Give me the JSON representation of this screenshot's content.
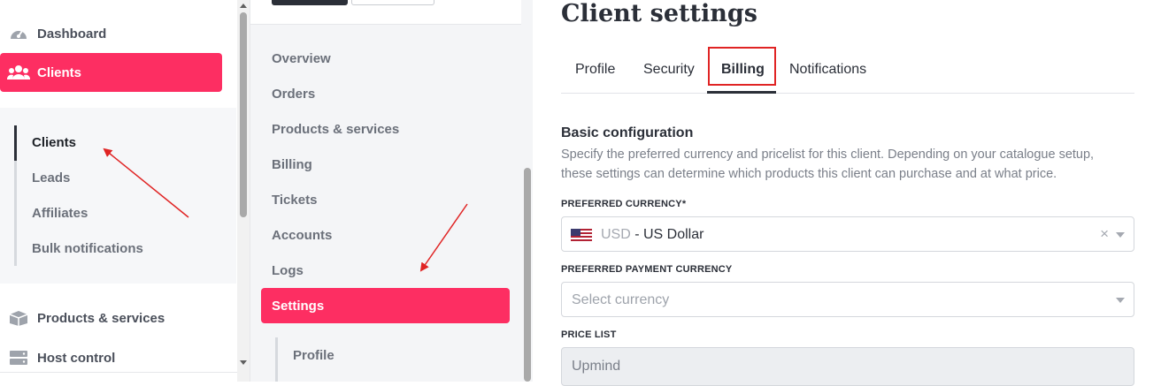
{
  "sidebar": {
    "items": [
      {
        "label": "Dashboard",
        "icon": "speedometer-icon"
      },
      {
        "label": "Clients",
        "icon": "users-icon",
        "active": true
      },
      {
        "label": "Products & services",
        "icon": "box-icon"
      },
      {
        "label": "Host control",
        "icon": "server-icon"
      }
    ],
    "sub_items": [
      "Clients",
      "Leads",
      "Affiliates",
      "Bulk notifications"
    ]
  },
  "midnav": {
    "items": [
      "Overview",
      "Orders",
      "Products & services",
      "Billing",
      "Tickets",
      "Accounts",
      "Logs"
    ],
    "active": "Settings",
    "sub_items": [
      "Profile"
    ]
  },
  "main": {
    "title": "Client settings",
    "tabs": [
      "Profile",
      "Security",
      "Billing",
      "Notifications"
    ],
    "active_tab": "Billing",
    "section": {
      "title": "Basic configuration",
      "description": "Specify the preferred currency and pricelist for this client. Depending on your catalogue setup, these settings can determine which products this client can purchase and at what price."
    },
    "fields": {
      "preferred_currency": {
        "label": "PREFERRED CURRENCY*",
        "code": "USD",
        "value": " - US Dollar",
        "clear": "×"
      },
      "preferred_payment_currency": {
        "label": "PREFERRED PAYMENT CURRENCY",
        "placeholder": "Select currency"
      },
      "price_list": {
        "label": "PRICE LIST",
        "value": "Upmind"
      }
    }
  },
  "colors": {
    "accent": "#fd2e62",
    "annotation": "#e02424",
    "text": "#2b2f38"
  }
}
